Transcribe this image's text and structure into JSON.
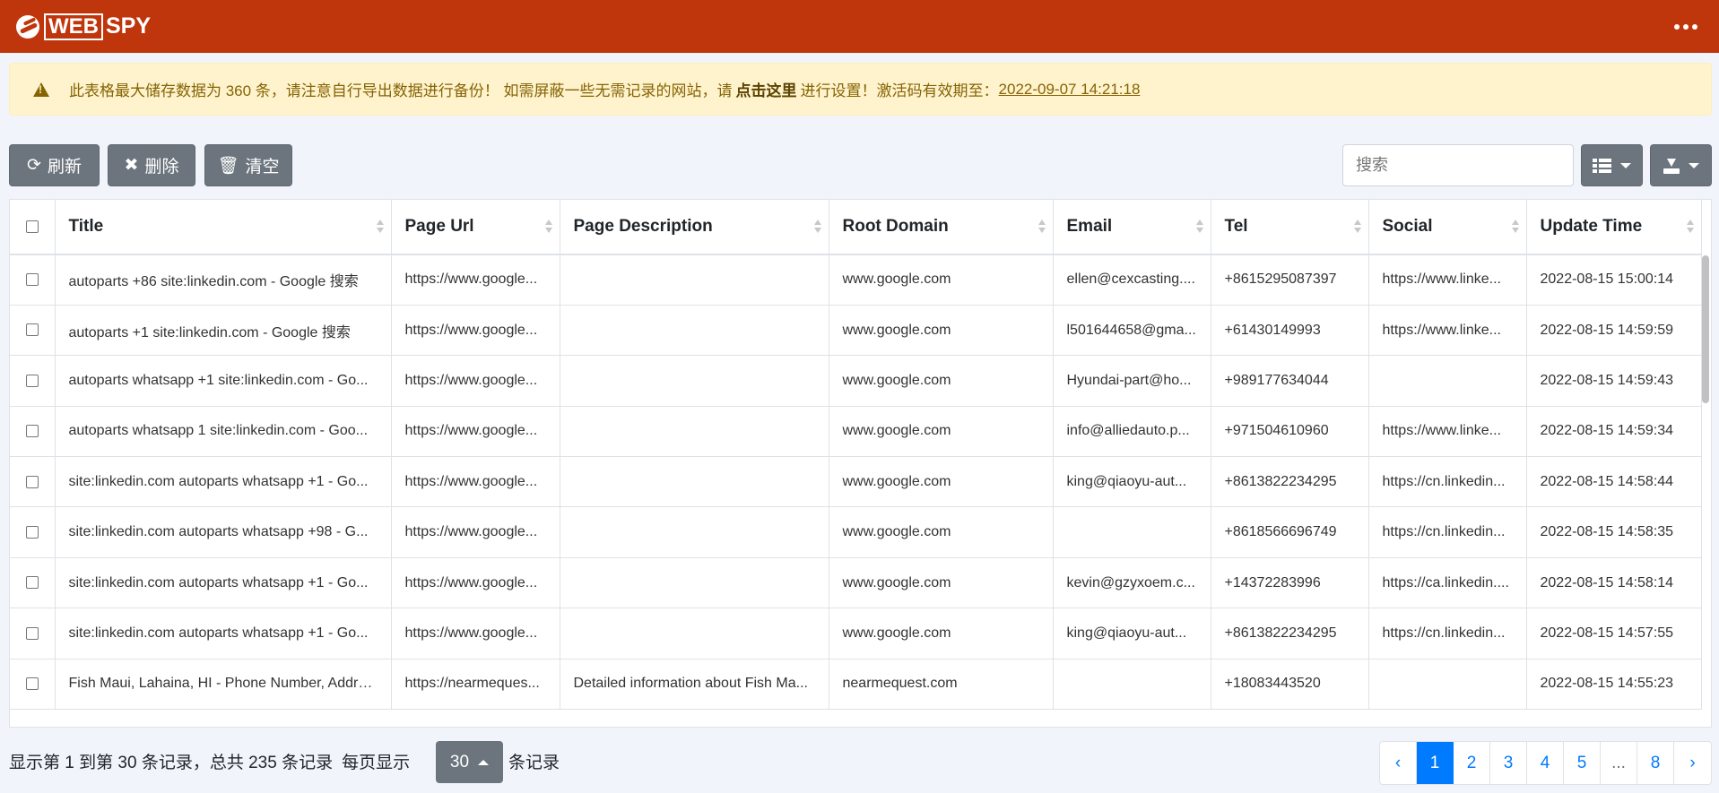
{
  "header": {
    "logo_boxed": "WEB",
    "logo_rest": "SPY",
    "menu_icon": "more-dots-icon"
  },
  "alert": {
    "icon": "warning-triangle-icon",
    "text_before": "此表格最大储存数据为 360 条，请注意自行导出数据进行备份！ 如需屏蔽一些无需记录的网站，请",
    "link_text": "点击这里",
    "text_after": "进行设置！激活码有效期至：",
    "expiry": "2022-09-07 14:21:18"
  },
  "toolbar": {
    "refresh_label": "刷新",
    "delete_label": "删除",
    "clear_label": "清空",
    "search_placeholder": "搜索",
    "columns_icon": "list-grid-icon",
    "export_icon": "download-icon"
  },
  "table": {
    "columns": [
      "Title",
      "Page Url",
      "Page Description",
      "Root Domain",
      "Email",
      "Tel",
      "Social",
      "Update Time"
    ],
    "rows": [
      [
        "autoparts +86 site:linkedin.com - Google 搜索",
        "https://www.google...",
        "",
        "www.google.com",
        "ellen@cexcasting....",
        "+8615295087397",
        "https://www.linke...",
        "2022-08-15 15:00:14"
      ],
      [
        "autoparts +1 site:linkedin.com - Google 搜索",
        "https://www.google...",
        "",
        "www.google.com",
        "l501644658@gma...",
        "+61430149993",
        "https://www.linke...",
        "2022-08-15 14:59:59"
      ],
      [
        "autoparts whatsapp +1 site:linkedin.com - Go...",
        "https://www.google...",
        "",
        "www.google.com",
        "Hyundai-part@ho...",
        "+989177634044",
        "",
        "2022-08-15 14:59:43"
      ],
      [
        "autoparts whatsapp 1 site:linkedin.com - Goo...",
        "https://www.google...",
        "",
        "www.google.com",
        "info@alliedauto.p...",
        "+971504610960",
        "https://www.linke...",
        "2022-08-15 14:59:34"
      ],
      [
        "site:linkedin.com autoparts whatsapp +1 - Go...",
        "https://www.google...",
        "",
        "www.google.com",
        "king@qiaoyu-aut...",
        "+8613822234295",
        "https://cn.linkedin...",
        "2022-08-15 14:58:44"
      ],
      [
        "site:linkedin.com autoparts whatsapp +98 - G...",
        "https://www.google...",
        "",
        "www.google.com",
        "",
        "+8618566696749",
        "https://cn.linkedin...",
        "2022-08-15 14:58:35"
      ],
      [
        "site:linkedin.com autoparts whatsapp +1 - Go...",
        "https://www.google...",
        "",
        "www.google.com",
        "kevin@gzyxoem.c...",
        "+14372283996",
        "https://ca.linkedin....",
        "2022-08-15 14:58:14"
      ],
      [
        "site:linkedin.com autoparts whatsapp +1 - Go...",
        "https://www.google...",
        "",
        "www.google.com",
        "king@qiaoyu-aut...",
        "+8613822234295",
        "https://cn.linkedin...",
        "2022-08-15 14:57:55"
      ],
      [
        "Fish Maui, Lahaina, HI - Phone Number, Addre...",
        "https://nearmeques...",
        "Detailed information about Fish Ma...",
        "nearmequest.com",
        "",
        "+18083443520",
        "",
        "2022-08-15 14:55:23"
      ]
    ]
  },
  "footer": {
    "summary": "显示第 1 到第 30 条记录，总共 235 条记录",
    "per_page_prefix": "每页显示",
    "page_size": "30",
    "per_page_suffix": "条记录",
    "pages": [
      "‹",
      "1",
      "2",
      "3",
      "4",
      "5",
      "...",
      "8",
      "›"
    ],
    "active_page": "1"
  },
  "colors": {
    "header_bg": "#c0360c",
    "alert_bg": "#fff3cd",
    "button_bg": "#6c757d",
    "page_active": "#007bff"
  }
}
